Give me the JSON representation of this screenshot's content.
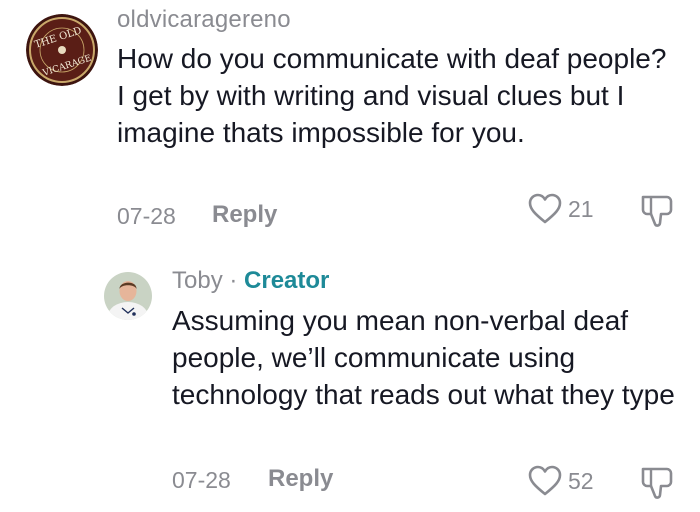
{
  "comment": {
    "username": "oldvicaragereno",
    "avatar_logo_lines": [
      "THE OLD",
      "VICARAGE"
    ],
    "text": "How do you communicate with deaf people? I get by with writing and visual clues but I imagine thats impossible for you.",
    "date": "07-28",
    "reply_label": "Reply",
    "like_count": "21",
    "icons": {
      "like": "heart-outline-icon",
      "dislike": "thumbs-down-icon"
    }
  },
  "reply": {
    "username": "Toby",
    "separator": " · ",
    "creator_badge": "Creator",
    "text": "Assuming you mean non-verbal deaf people, we’ll communicate using technology that reads out what they type",
    "date": "07-28",
    "reply_label": "Reply",
    "like_count": "52",
    "icons": {
      "like": "heart-outline-icon",
      "dislike": "thumbs-down-icon"
    }
  },
  "colors": {
    "text": "#161823",
    "secondary": "#8a8b91",
    "creator": "#1e8a98",
    "avatar_logo_bg": "#5a1e16",
    "avatar_logo_ring": "#c9a86a"
  }
}
